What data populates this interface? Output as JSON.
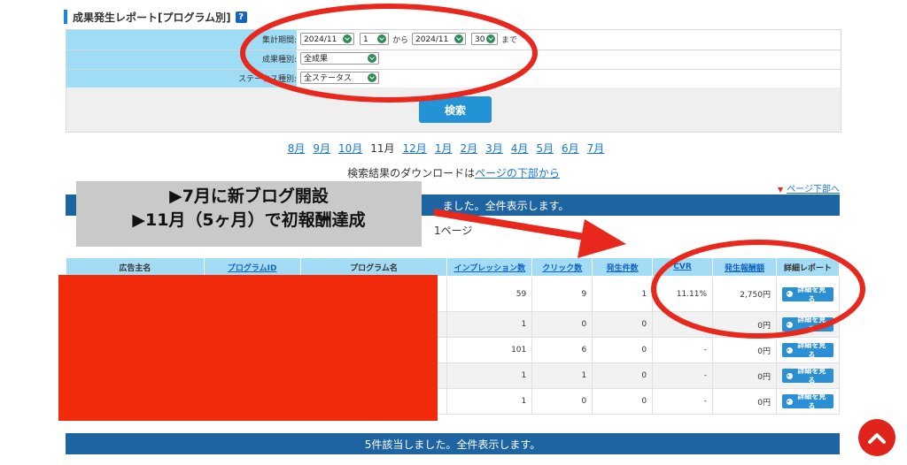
{
  "header": {
    "title": "成果発生レポート[プログラム別]",
    "help_icon": "?"
  },
  "filters": {
    "period_label": "集計期間:",
    "from_month": "2024/11",
    "from_day": "1",
    "from_word": "から",
    "to_month": "2024/11",
    "to_day": "30",
    "to_word": "まで",
    "type_label": "成果種別:",
    "type_value": "全成果",
    "status_label": "ステータス種別:",
    "status_value": "全ステータス"
  },
  "search_button": "検索",
  "months": [
    "8月",
    "9月",
    "10月",
    "11月",
    "12月",
    "1月",
    "2月",
    "3月",
    "4月",
    "5月",
    "6月",
    "7月"
  ],
  "current_month": "11月",
  "download": {
    "prefix": "検索結果のダウンロードは",
    "link": "ページの下部から"
  },
  "page_bottom_link": "ページ下部へ",
  "result_banner_top": "ました。全件表示します。",
  "result_banner_bottom": "5件該当しました。全件表示します。",
  "overlay": {
    "line1": "▶7月に新ブログ開設",
    "line2": "▶11月（5ヶ月）で初報酬達成"
  },
  "page_label": "1ページ",
  "table": {
    "headers": [
      "広告主名",
      "プログラムID",
      "プログラム名",
      "インプレッション数",
      "クリック数",
      "発生件数",
      "CVR",
      "発生報酬額",
      "詳細レポート"
    ],
    "detail_button": "詳細を見る",
    "rows": [
      {
        "impressions": "59",
        "clicks": "9",
        "count": "1",
        "cvr": "11.11%",
        "reward": "2,750円"
      },
      {
        "impressions": "1",
        "clicks": "0",
        "count": "0",
        "cvr": "",
        "reward": "0円"
      },
      {
        "impressions": "101",
        "clicks": "6",
        "count": "0",
        "cvr": "-",
        "reward": "0円"
      },
      {
        "impressions": "1",
        "clicks": "1",
        "count": "0",
        "cvr": "-",
        "reward": "0円"
      },
      {
        "impressions": "1",
        "clicks": "0",
        "count": "0",
        "cvr": "-",
        "reward": "0円"
      }
    ]
  },
  "colors": {
    "annotation_red": "#e8281c",
    "header_blue": "#a4dcf5",
    "banner_blue": "#1e64a0",
    "button_blue": "#2a8fd4"
  },
  "icons": {
    "scroll_top": "chevron-up-icon",
    "dropdown": "chevron-down-icon"
  }
}
